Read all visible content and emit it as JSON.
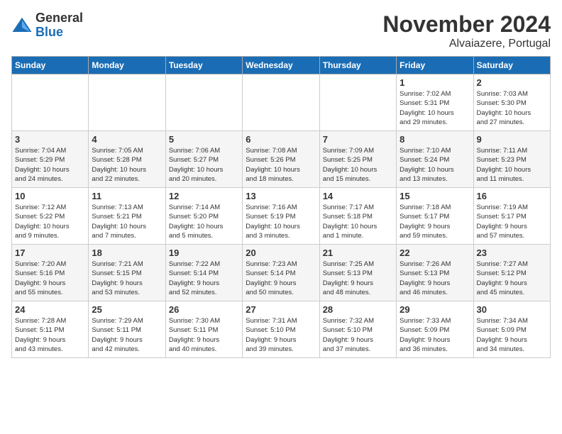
{
  "logo": {
    "general": "General",
    "blue": "Blue"
  },
  "title": "November 2024",
  "subtitle": "Alvaiazere, Portugal",
  "days_header": [
    "Sunday",
    "Monday",
    "Tuesday",
    "Wednesday",
    "Thursday",
    "Friday",
    "Saturday"
  ],
  "weeks": [
    [
      {
        "num": "",
        "detail": ""
      },
      {
        "num": "",
        "detail": ""
      },
      {
        "num": "",
        "detail": ""
      },
      {
        "num": "",
        "detail": ""
      },
      {
        "num": "",
        "detail": ""
      },
      {
        "num": "1",
        "detail": "Sunrise: 7:02 AM\nSunset: 5:31 PM\nDaylight: 10 hours\nand 29 minutes."
      },
      {
        "num": "2",
        "detail": "Sunrise: 7:03 AM\nSunset: 5:30 PM\nDaylight: 10 hours\nand 27 minutes."
      }
    ],
    [
      {
        "num": "3",
        "detail": "Sunrise: 7:04 AM\nSunset: 5:29 PM\nDaylight: 10 hours\nand 24 minutes."
      },
      {
        "num": "4",
        "detail": "Sunrise: 7:05 AM\nSunset: 5:28 PM\nDaylight: 10 hours\nand 22 minutes."
      },
      {
        "num": "5",
        "detail": "Sunrise: 7:06 AM\nSunset: 5:27 PM\nDaylight: 10 hours\nand 20 minutes."
      },
      {
        "num": "6",
        "detail": "Sunrise: 7:08 AM\nSunset: 5:26 PM\nDaylight: 10 hours\nand 18 minutes."
      },
      {
        "num": "7",
        "detail": "Sunrise: 7:09 AM\nSunset: 5:25 PM\nDaylight: 10 hours\nand 15 minutes."
      },
      {
        "num": "8",
        "detail": "Sunrise: 7:10 AM\nSunset: 5:24 PM\nDaylight: 10 hours\nand 13 minutes."
      },
      {
        "num": "9",
        "detail": "Sunrise: 7:11 AM\nSunset: 5:23 PM\nDaylight: 10 hours\nand 11 minutes."
      }
    ],
    [
      {
        "num": "10",
        "detail": "Sunrise: 7:12 AM\nSunset: 5:22 PM\nDaylight: 10 hours\nand 9 minutes."
      },
      {
        "num": "11",
        "detail": "Sunrise: 7:13 AM\nSunset: 5:21 PM\nDaylight: 10 hours\nand 7 minutes."
      },
      {
        "num": "12",
        "detail": "Sunrise: 7:14 AM\nSunset: 5:20 PM\nDaylight: 10 hours\nand 5 minutes."
      },
      {
        "num": "13",
        "detail": "Sunrise: 7:16 AM\nSunset: 5:19 PM\nDaylight: 10 hours\nand 3 minutes."
      },
      {
        "num": "14",
        "detail": "Sunrise: 7:17 AM\nSunset: 5:18 PM\nDaylight: 10 hours\nand 1 minute."
      },
      {
        "num": "15",
        "detail": "Sunrise: 7:18 AM\nSunset: 5:17 PM\nDaylight: 9 hours\nand 59 minutes."
      },
      {
        "num": "16",
        "detail": "Sunrise: 7:19 AM\nSunset: 5:17 PM\nDaylight: 9 hours\nand 57 minutes."
      }
    ],
    [
      {
        "num": "17",
        "detail": "Sunrise: 7:20 AM\nSunset: 5:16 PM\nDaylight: 9 hours\nand 55 minutes."
      },
      {
        "num": "18",
        "detail": "Sunrise: 7:21 AM\nSunset: 5:15 PM\nDaylight: 9 hours\nand 53 minutes."
      },
      {
        "num": "19",
        "detail": "Sunrise: 7:22 AM\nSunset: 5:14 PM\nDaylight: 9 hours\nand 52 minutes."
      },
      {
        "num": "20",
        "detail": "Sunrise: 7:23 AM\nSunset: 5:14 PM\nDaylight: 9 hours\nand 50 minutes."
      },
      {
        "num": "21",
        "detail": "Sunrise: 7:25 AM\nSunset: 5:13 PM\nDaylight: 9 hours\nand 48 minutes."
      },
      {
        "num": "22",
        "detail": "Sunrise: 7:26 AM\nSunset: 5:13 PM\nDaylight: 9 hours\nand 46 minutes."
      },
      {
        "num": "23",
        "detail": "Sunrise: 7:27 AM\nSunset: 5:12 PM\nDaylight: 9 hours\nand 45 minutes."
      }
    ],
    [
      {
        "num": "24",
        "detail": "Sunrise: 7:28 AM\nSunset: 5:11 PM\nDaylight: 9 hours\nand 43 minutes."
      },
      {
        "num": "25",
        "detail": "Sunrise: 7:29 AM\nSunset: 5:11 PM\nDaylight: 9 hours\nand 42 minutes."
      },
      {
        "num": "26",
        "detail": "Sunrise: 7:30 AM\nSunset: 5:11 PM\nDaylight: 9 hours\nand 40 minutes."
      },
      {
        "num": "27",
        "detail": "Sunrise: 7:31 AM\nSunset: 5:10 PM\nDaylight: 9 hours\nand 39 minutes."
      },
      {
        "num": "28",
        "detail": "Sunrise: 7:32 AM\nSunset: 5:10 PM\nDaylight: 9 hours\nand 37 minutes."
      },
      {
        "num": "29",
        "detail": "Sunrise: 7:33 AM\nSunset: 5:09 PM\nDaylight: 9 hours\nand 36 minutes."
      },
      {
        "num": "30",
        "detail": "Sunrise: 7:34 AM\nSunset: 5:09 PM\nDaylight: 9 hours\nand 34 minutes."
      }
    ]
  ]
}
